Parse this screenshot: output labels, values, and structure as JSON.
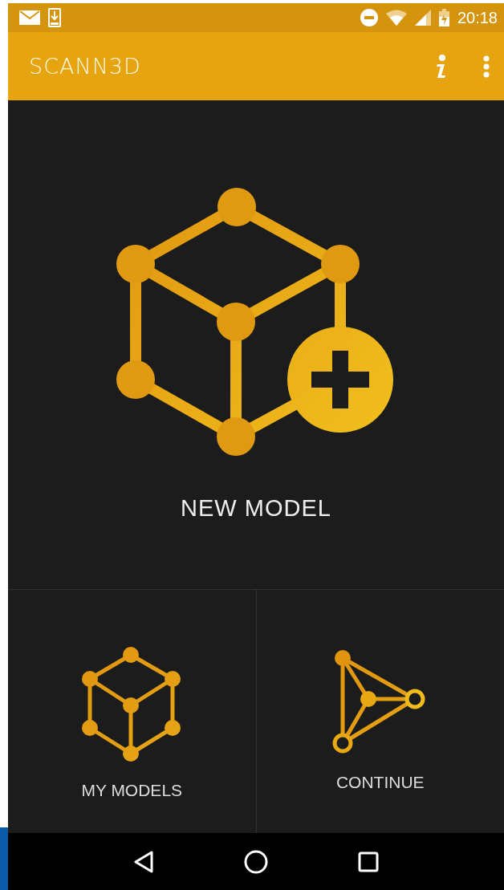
{
  "status_bar": {
    "time": "20:18"
  },
  "app_bar": {
    "title": "SCANN3D"
  },
  "main_tile": {
    "label": "NEW MODEL"
  },
  "tiles": [
    {
      "kind": "models",
      "label": "MY MODELS"
    },
    {
      "kind": "continue",
      "label": "CONTINUE"
    }
  ]
}
